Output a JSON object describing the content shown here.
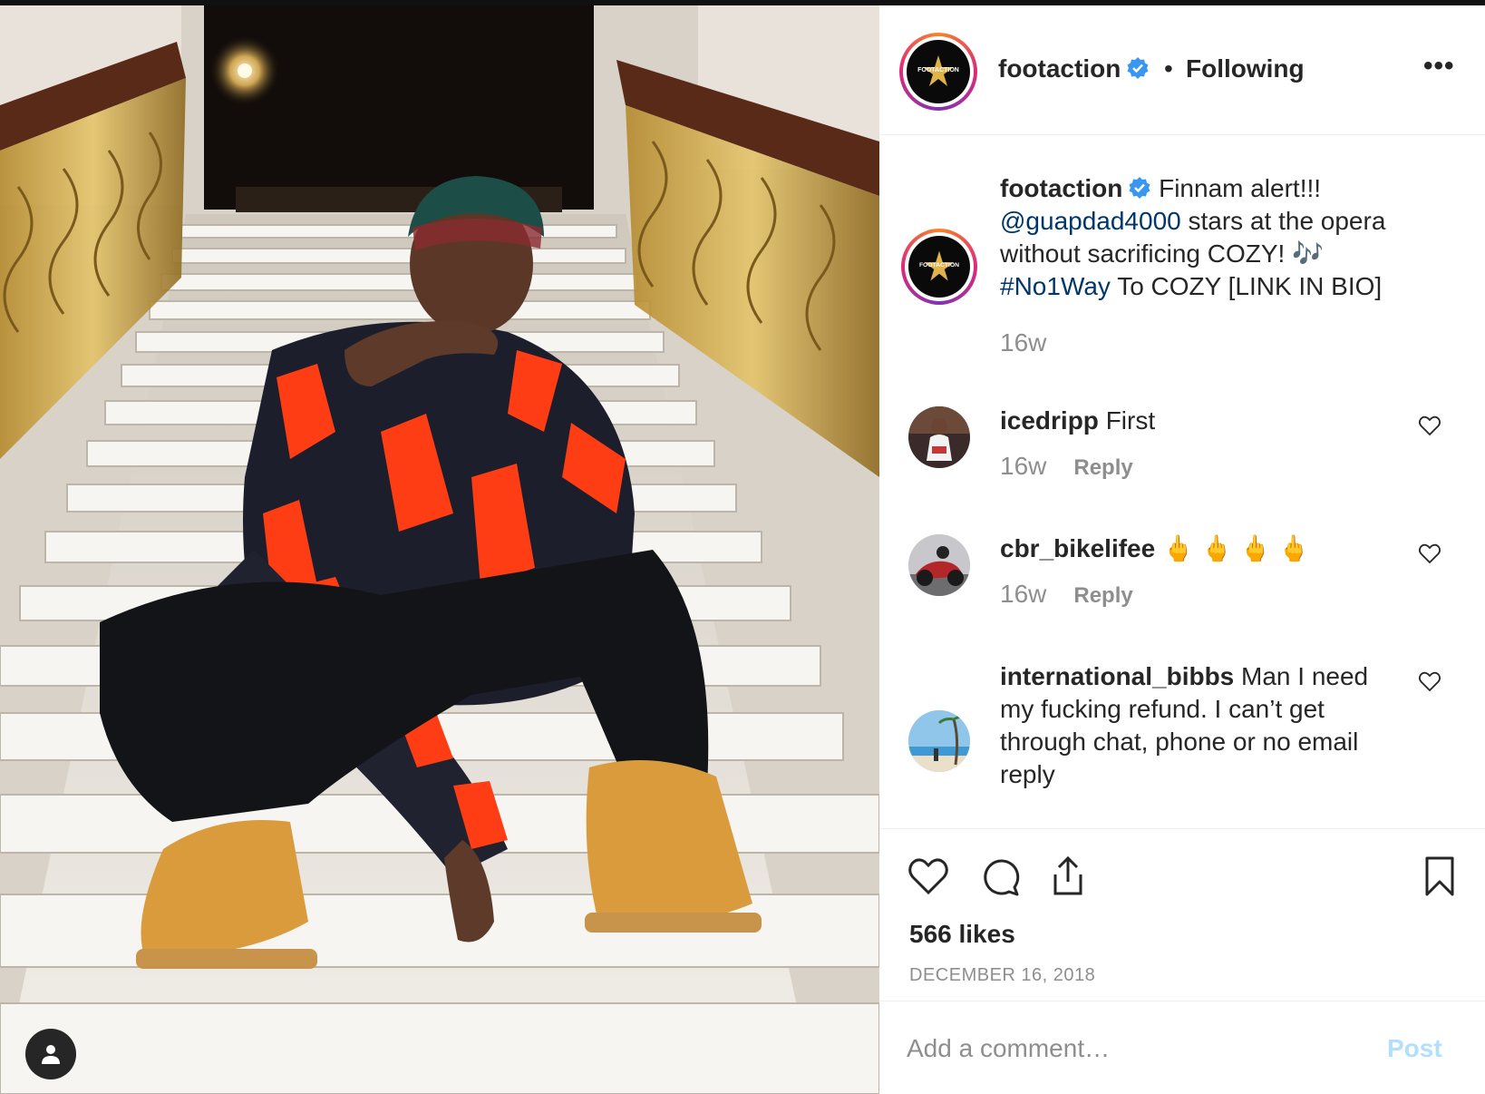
{
  "post": {
    "image_alt": "Man in red and black puffer jacket and tan boots sitting on marble staircase",
    "header": {
      "username": "footaction",
      "separator": "•",
      "follow_status": "Following",
      "more_label": "•••",
      "logo_text": "FOOTACTION"
    },
    "caption": {
      "username": "footaction",
      "text_1": "Finnam alert!!!",
      "mention": "@guapdad4000",
      "text_2": "stars at the opera without sacrificing COZY! 🎶",
      "hashtag": "#No1Way",
      "text_3": "To COZY [LINK IN BIO]",
      "age": "16w"
    },
    "comments": [
      {
        "username": "icedripp",
        "text": "First",
        "age": "16w",
        "reply_label": "Reply"
      },
      {
        "username": "cbr_bikelifee",
        "text": "🖕 🖕 🖕 🖕",
        "age": "16w",
        "reply_label": "Reply"
      },
      {
        "username": "international_bibbs",
        "text": "Man I need my fucking refund. I can’t get through chat, phone or no email reply"
      }
    ],
    "likes": "566 likes",
    "date": "DECEMBER 16, 2018",
    "add_comment": {
      "placeholder": "Add a comment…",
      "post_label": "Post"
    }
  },
  "colors": {
    "text": "#262626",
    "secondary": "#8e8e8e",
    "link": "#00376b",
    "verified": "#3897f0",
    "post_disabled": "#b2dffc"
  },
  "icons": [
    "verified-icon",
    "more-icon",
    "heart-icon",
    "comment-icon",
    "share-icon",
    "bookmark-icon",
    "user-tag-icon"
  ]
}
